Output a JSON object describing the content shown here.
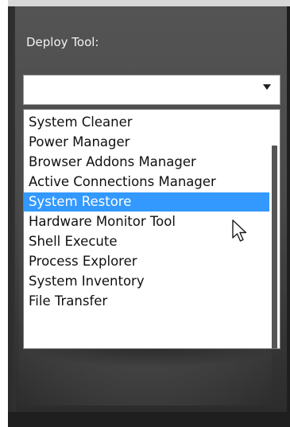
{
  "deploy_tool": {
    "label": "Deploy Tool:",
    "selected_value": "",
    "arrow_icon": "chevron-down-icon"
  },
  "dropdown": {
    "options": [
      "System Cleaner",
      "Power Manager",
      "Browser Addons Manager",
      "Active Connections Manager",
      "System Restore",
      "Hardware Monitor Tool",
      "Shell Execute",
      "Process Explorer",
      "System Inventory",
      "File Transfer"
    ],
    "highlighted": "System Restore",
    "highlight_color": "#3399ff"
  },
  "cursor": {
    "icon": "mouse-pointer-icon"
  }
}
